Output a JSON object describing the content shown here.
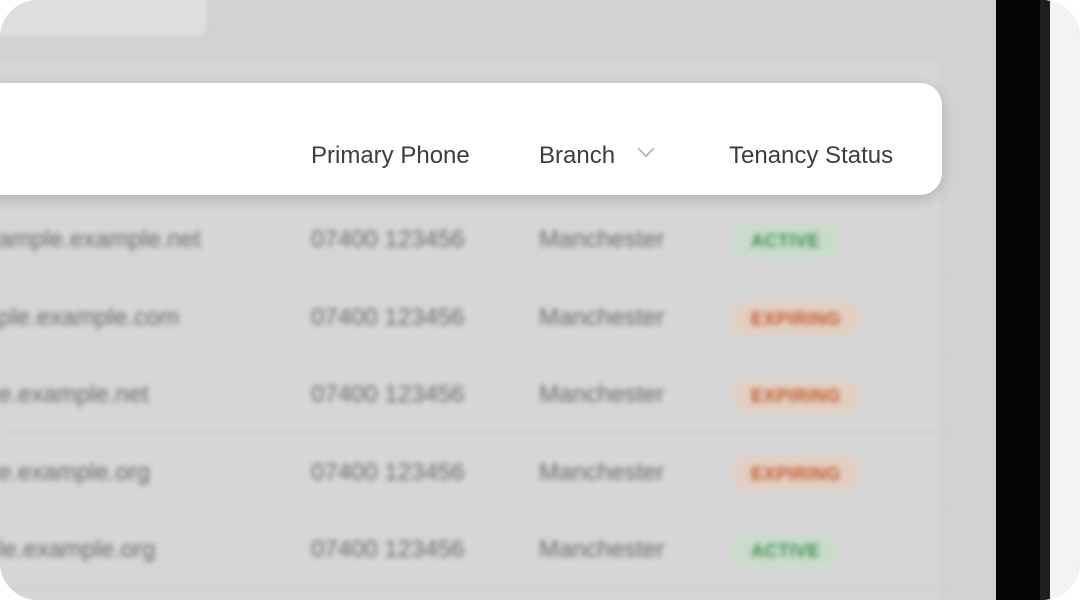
{
  "table": {
    "columns": {
      "phone": "Primary Phone",
      "branch": "Branch",
      "status": "Tenancy Status"
    },
    "rows": [
      {
        "email": "ample.example.net",
        "phone": "07400 123456",
        "branch": "Manchester",
        "status": "ACTIVE",
        "status_type": "active"
      },
      {
        "email": "ple.example.com",
        "phone": "07400 123456",
        "branch": "Manchester",
        "status": "EXPIRING",
        "status_type": "expiring"
      },
      {
        "email": "e.example.net",
        "phone": "07400 123456",
        "branch": "Manchester",
        "status": "EXPIRING",
        "status_type": "expiring"
      },
      {
        "email": "e.example.org",
        "phone": "07400 123456",
        "branch": "Manchester",
        "status": "EXPIRING",
        "status_type": "expiring"
      },
      {
        "email": "le.example.org",
        "phone": "07400 123456",
        "branch": "Manchester",
        "status": "ACTIVE",
        "status_type": "active"
      }
    ]
  },
  "icons": {
    "branch_sort": "chevron-down-icon",
    "top_control": "chevron-down-icon"
  },
  "colors": {
    "active_text": "#3e8a4f",
    "active_bg": "#c9dccb",
    "expiring_text": "#c35a2c",
    "expiring_bg": "#e2cfc2"
  }
}
